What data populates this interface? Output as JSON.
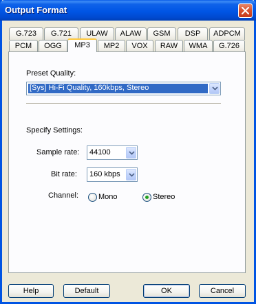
{
  "window": {
    "title": "Output Format"
  },
  "tabs_row1": [
    "G.723",
    "G.721",
    "ULAW",
    "ALAW",
    "GSM",
    "DSP",
    "ADPCM"
  ],
  "tabs_row2": [
    "PCM",
    "OGG",
    "MP3",
    "MP2",
    "VOX",
    "RAW",
    "WMA",
    "G.726"
  ],
  "active_tab": "MP3",
  "preset": {
    "label": "Preset Quality:",
    "value": "[Sys] Hi-Fi Quality, 160kbps, Stereo"
  },
  "settings": {
    "heading": "Specify Settings:",
    "sample_rate_label": "Sample rate:",
    "sample_rate_value": "44100",
    "bit_rate_label": "Bit rate:",
    "bit_rate_value": "160 kbps",
    "channel_label": "Channel:",
    "channel_options": [
      "Mono",
      "Stereo"
    ],
    "channel_selected": "Stereo"
  },
  "buttons": {
    "help": "Help",
    "default": "Default",
    "ok": "OK",
    "cancel": "Cancel"
  },
  "colors": {
    "titlebar": "#0055e5",
    "selection": "#316ac5",
    "radio_dot": "#21a121",
    "active_tab_accent": "#ffc83c"
  }
}
